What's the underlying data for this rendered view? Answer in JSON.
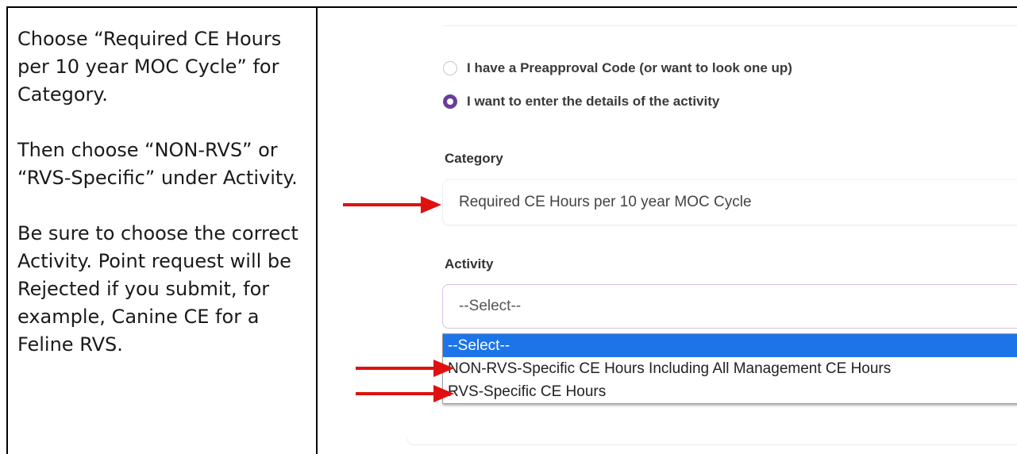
{
  "instructions": {
    "p1": "Choose “Required CE Hours per 10 year MOC Cycle” for Category.",
    "p2": "Then choose “NON-RVS” or “RVS-Specific” under Activity.",
    "p3": "Be sure to choose the correct Activity. Point request will be Rejected if you submit, for example, Canine CE for a Feline RVS."
  },
  "form": {
    "radio_options": [
      {
        "label": "I have a Preapproval Code (or want to look one up)",
        "checked": false
      },
      {
        "label": "I want to enter the details of the activity",
        "checked": true
      }
    ],
    "category": {
      "label": "Category",
      "value": "Required CE Hours per 10 year MOC Cycle"
    },
    "activity": {
      "label": "Activity",
      "value": "--Select--",
      "options": [
        {
          "label": "--Select--",
          "selected": true
        },
        {
          "label": "NON-RVS-Specific CE Hours Including All Management CE Hours",
          "selected": false
        },
        {
          "label": "RVS-Specific CE Hours",
          "selected": false
        }
      ]
    }
  },
  "colors": {
    "accent_purple": "#6a3e96",
    "annotation_arrow": "#e01010",
    "dropdown_highlight": "#1c74e8"
  }
}
